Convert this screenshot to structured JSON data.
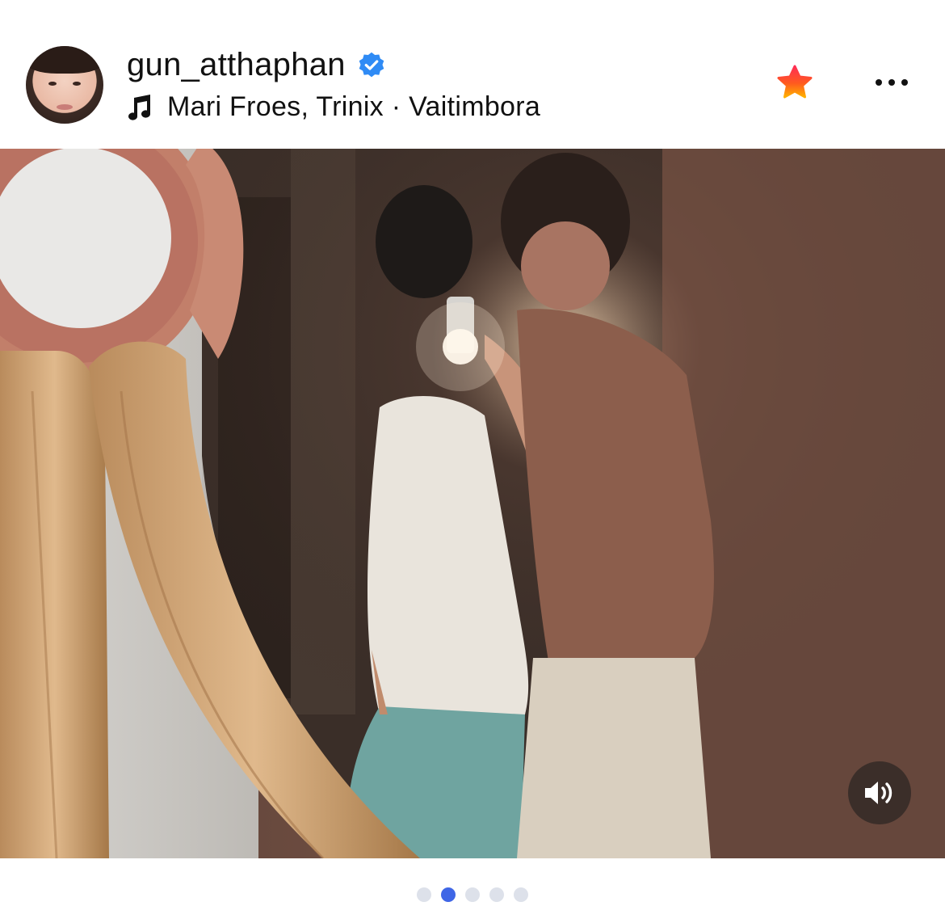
{
  "post": {
    "username": "gun_atthaphan",
    "verified": true,
    "music": "Mari Froes, Trinix · Vaitimbora"
  },
  "carousel": {
    "page_count": 5,
    "active_index": 1
  },
  "icons": {
    "verified": "verified-badge-icon",
    "music": "music-note-icon",
    "favorite": "star-icon",
    "more": "more-options-icon",
    "sound": "speaker-icon"
  },
  "colors": {
    "verified_blue": "#2f8bf5",
    "star_orange": "#ff5a1f",
    "active_dot": "#3f66e6",
    "inactive_dot": "#dde1ea"
  }
}
